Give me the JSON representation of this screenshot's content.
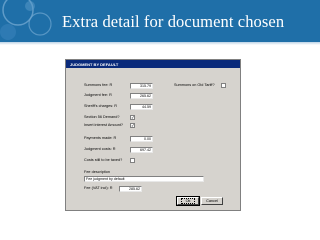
{
  "slide": {
    "title": "Extra detail for document chosen"
  },
  "dialog": {
    "title": "JUDGMENT BY DEFAULT",
    "fields": {
      "summons_fee": {
        "label": "Summons fee: R",
        "value": "315.79"
      },
      "judgment_fee": {
        "label": "Judgment fee: R",
        "value": "265.62"
      },
      "sheriffs_charges": {
        "label": "Sheriff's charges: R",
        "value": "44.59"
      },
      "payments_made": {
        "label": "Payments made: R",
        "value": "0.00"
      },
      "judgment_costs": {
        "label": "Judgment costs: R",
        "value": "697.42"
      },
      "fee_description": {
        "label": "Fee description",
        "value": "Fee judgment by default"
      },
      "fee_vat_incl": {
        "label": "Fee (VAT incl): R",
        "value": "285.62"
      }
    },
    "checks": {
      "summons_old_tariff": {
        "label": "Summons on Old Tariff?",
        "checked": false
      },
      "section_56_demand": {
        "label": "Section 56 Demand?",
        "checked": true
      },
      "insert_interest_amount": {
        "label": "Insert interest Amount?",
        "checked": true
      },
      "costs_still_to_be_taxed": {
        "label": "Costs still to be taxed?",
        "checked": false
      }
    },
    "buttons": {
      "ok": "Ok",
      "cancel": "Cancel"
    }
  }
}
